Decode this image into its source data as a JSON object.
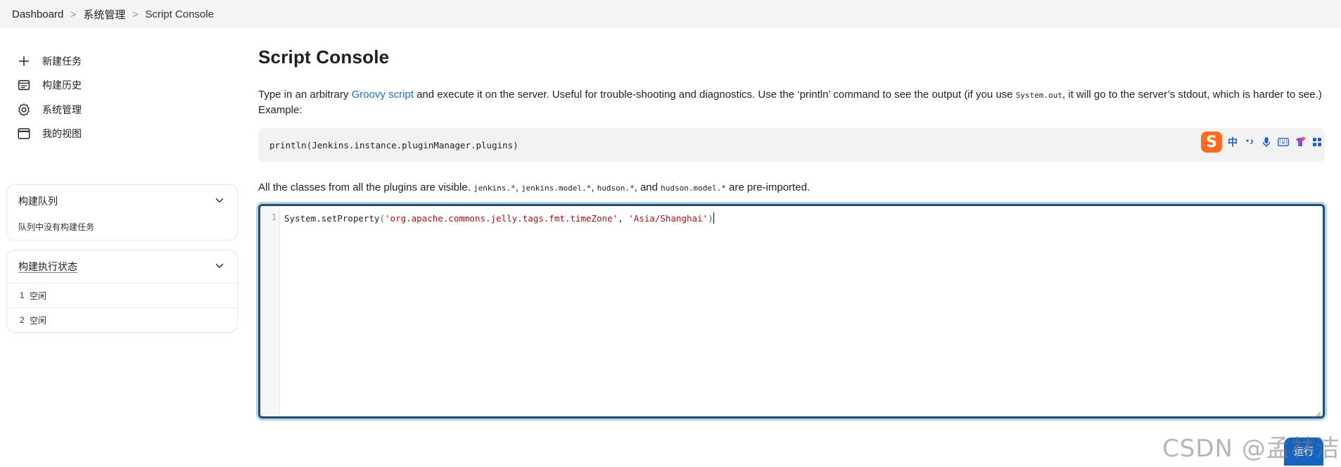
{
  "breadcrumb": {
    "items": [
      "Dashboard",
      "系统管理",
      "Script Console"
    ]
  },
  "sidebar": {
    "tasks": [
      {
        "label": "新建任务",
        "icon": "plus-icon"
      },
      {
        "label": "构建历史",
        "icon": "build-history-icon"
      },
      {
        "label": "系统管理",
        "icon": "gear-icon"
      },
      {
        "label": "我的视图",
        "icon": "window-icon"
      }
    ],
    "build_queue": {
      "title": "构建队列",
      "empty_text": "队列中没有构建任务"
    },
    "executors": {
      "title": "构建执行状态",
      "rows": [
        {
          "num": "1",
          "status": "空闲"
        },
        {
          "num": "2",
          "status": "空闲"
        }
      ]
    }
  },
  "main": {
    "title": "Script Console",
    "desc_part1": "Type in an arbitrary ",
    "desc_link": "Groovy script",
    "desc_part2": " and execute it on the server. Useful for trouble-shooting and diagnostics. Use the ‘println’ command to see the output (if you use ",
    "desc_code": "System.out",
    "desc_part3": ", it will go to the server’s stdout, which is harder to see.) Example:",
    "example_code": "println(Jenkins.instance.pluginManager.plugins)",
    "preimport_part1": "All the classes from all the plugins are visible. ",
    "preimport_code1": "jenkins.*",
    "preimport_sep1": ", ",
    "preimport_code2": "jenkins.model.*",
    "preimport_sep2": ", ",
    "preimport_code3": "hudson.*",
    "preimport_sep3": ", and ",
    "preimport_code4": "hudson.model.*",
    "preimport_part2": " are pre-imported.",
    "editor": {
      "line_number": "1",
      "code_prefix": "System.setProperty",
      "open_paren": "(",
      "arg1": "'org.apache.commons.jelly.tags.fmt.timeZone'",
      "comma": ", ",
      "arg2": "'Asia/Shanghai'",
      "close_paren": ")"
    },
    "run_label": "运行"
  },
  "ime": {
    "logo": "S",
    "lang": "中"
  },
  "watermark": "CSDN @孟林洁",
  "colors": {
    "link": "#1a6dd4",
    "editor_border": "#1e4f78",
    "run_button": "#1565c0",
    "string": "#aa1111"
  }
}
